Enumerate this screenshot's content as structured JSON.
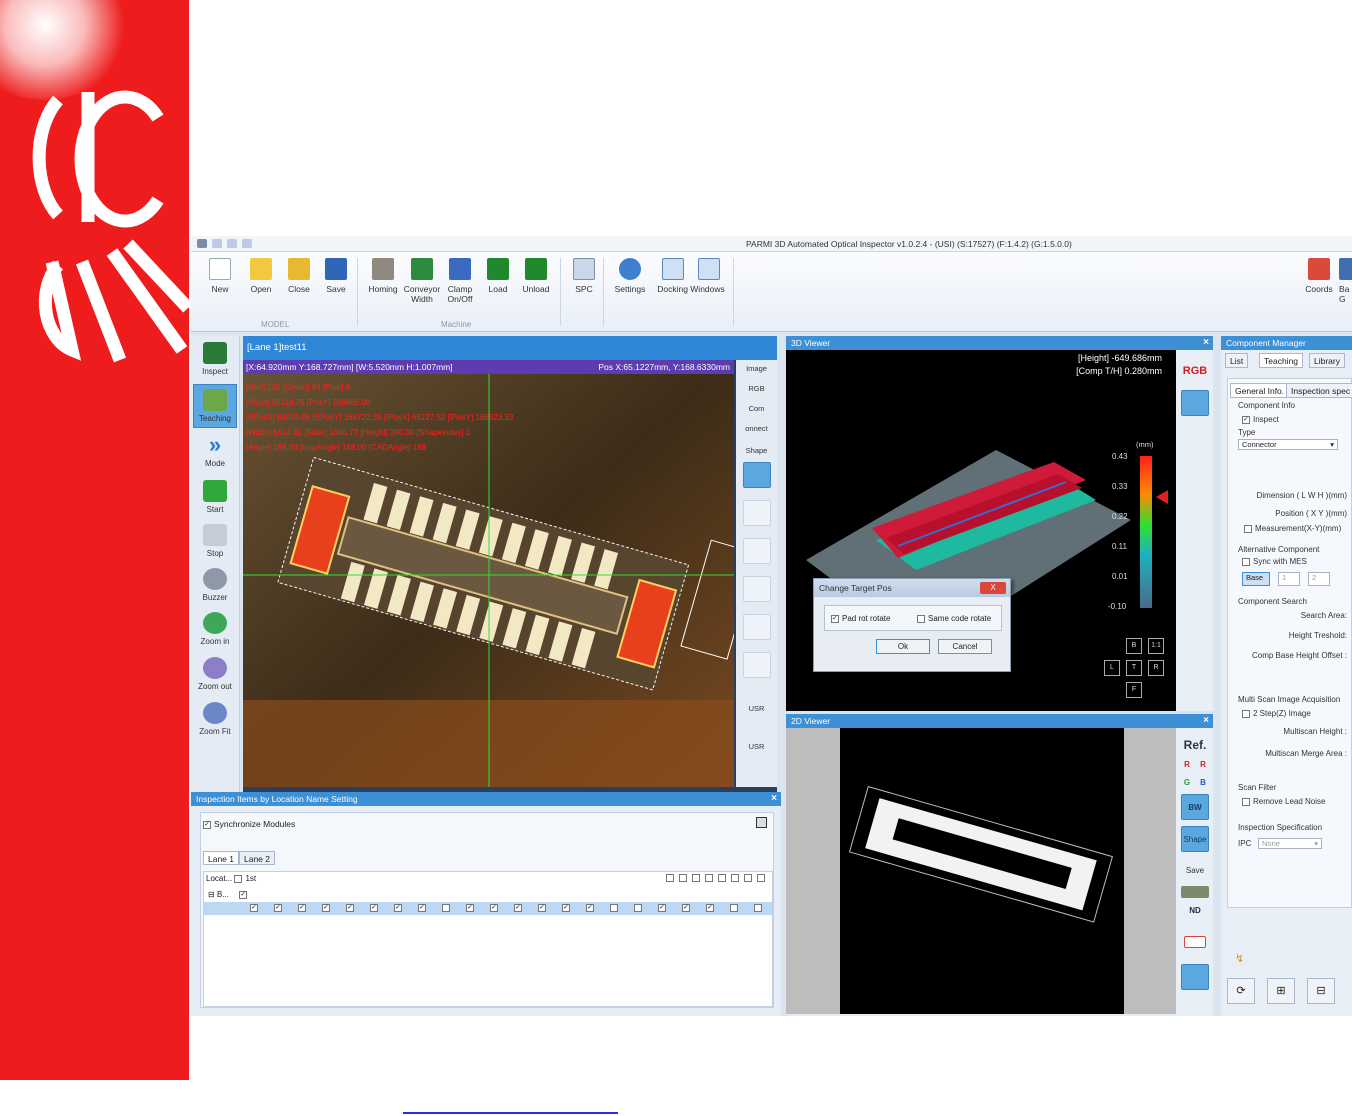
{
  "window": {
    "title": "PARMI 3D Automated Optical Inspector v1.0.2.4 - (USI) (S:17527) (F:1.4.2) (G:1.5.0.0)"
  },
  "ribbon": {
    "model_buttons": [
      "New",
      "Open",
      "Close",
      "Save"
    ],
    "model_group": "MODEL",
    "machine_buttons": [
      {
        "label": "Homing"
      },
      {
        "label": "Conveyor",
        "label2": "Width"
      },
      {
        "label": "Clamp",
        "label2": "On/Off"
      },
      {
        "label": "Load"
      },
      {
        "label": "Unload"
      }
    ],
    "machine_group": "Machine",
    "spc": "SPC",
    "settings": "Settings",
    "docking_windows": "Docking Windows",
    "coords": "Coords",
    "partial_right": "Ba G"
  },
  "tools": [
    "Inspect",
    "Teaching",
    "Mode",
    "Start",
    "Stop",
    "Buzzer",
    "Zoom in",
    "Zoom out",
    "Zoom Fit"
  ],
  "lane_view": {
    "title": "[Lane 1]test11",
    "info": "[X:64.920mm Y:168.727mm] [W:5.520mm H:1.007mm]",
    "pos": "Pos X:65.1227mm, Y:168.6330mm",
    "overlay_lines": [
      "[Red] 145 [Green] 84 [Blue] 6",
      "[PosX] 65118.76 [PosY] 168686.00",
      "[EPosX] 64919.96 [EPosY] 168722.39 [IPosX] 65127.52 [IPosY] 168623.33",
      "[Width] 5614.81 [Sizer] 1006.73 [Height] 280.00 [Shapeindex] 1",
      "[Angle] 168.00 [InspAngle] 168.00 [CADAngle] 168"
    ]
  },
  "image_strip": {
    "labels": [
      "Image",
      "RGB",
      "Com",
      "onnect",
      "Shape",
      "USR",
      "USR"
    ]
  },
  "inspection_items": {
    "title": "Inspection Items by Location Name Setting",
    "sync_label": "Synchronize Modules",
    "tabs": [
      "Lane 1",
      "Lane 2"
    ],
    "col_location": "Locat...",
    "col_first": "1st",
    "row_group": "B..."
  },
  "viewer3d": {
    "title": "3D Viewer",
    "height_line": "[Height] -649.686mm",
    "thk_line": "[Comp T/H] 0.280mm",
    "scale_unit": "(mm)",
    "scale_values": [
      "0.43",
      "0.33",
      "0.22",
      "0.11",
      "0.01",
      "-0.10"
    ],
    "nav": [
      "B",
      "1:1",
      "L",
      "T",
      "R",
      "F"
    ],
    "side_buttons": [
      "RGB"
    ]
  },
  "dialog": {
    "title": "Change Target Pos",
    "close": "X",
    "option1": "Pad rot rotate",
    "option2": "Same code rotate",
    "ok": "Ok",
    "cancel": "Cancel"
  },
  "viewer2d": {
    "title": "2D Viewer",
    "ref": "Ref.",
    "r": "R",
    "g": "G",
    "b": "B",
    "bw": "BW",
    "shape": "Shape",
    "save": "Save",
    "nd": "ND"
  },
  "component_manager": {
    "title": "Component Manager",
    "tabs": [
      "List",
      "Teaching",
      "Library"
    ],
    "subtabs": [
      "General Info.",
      "Inspection spec"
    ],
    "component_info": "Component Info",
    "inspect": "Inspect",
    "type_label": "Type",
    "type_value": "Connector",
    "dimension": "Dimension ( L W H )(mm)",
    "position": "Position ( X Y )(mm)",
    "measurement": "Measurement(X-Y)(mm)",
    "alt_component": "Alternative Component",
    "sync_mes": "Sync with MES",
    "base_buttons": [
      "Base",
      "1",
      "2"
    ],
    "comp_search": "Component Search",
    "search_area": "Search Area:",
    "height_threshold": "Height Treshold:",
    "comp_base_offset": "Comp Base Height Offset :",
    "multiscan": "Multi Scan Image Acquisition",
    "two_step": "2 Step(Z) Image",
    "multiscan_height": "Multiscan Height :",
    "multiscan_merge": "Multiscan Merge Area :",
    "scan_filter": "Scan Filter",
    "remove_lead_noise": "Remove Lead Noise",
    "inspection_spec": "Inspection Specification",
    "ipc_label": "IPC",
    "ipc_value": "None"
  },
  "colors": {
    "brand_red": "#ee1c1c",
    "pane_blue": "#3d8fd6",
    "info_purple": "#5d3bb0",
    "overlay_red": "#ff2020"
  }
}
